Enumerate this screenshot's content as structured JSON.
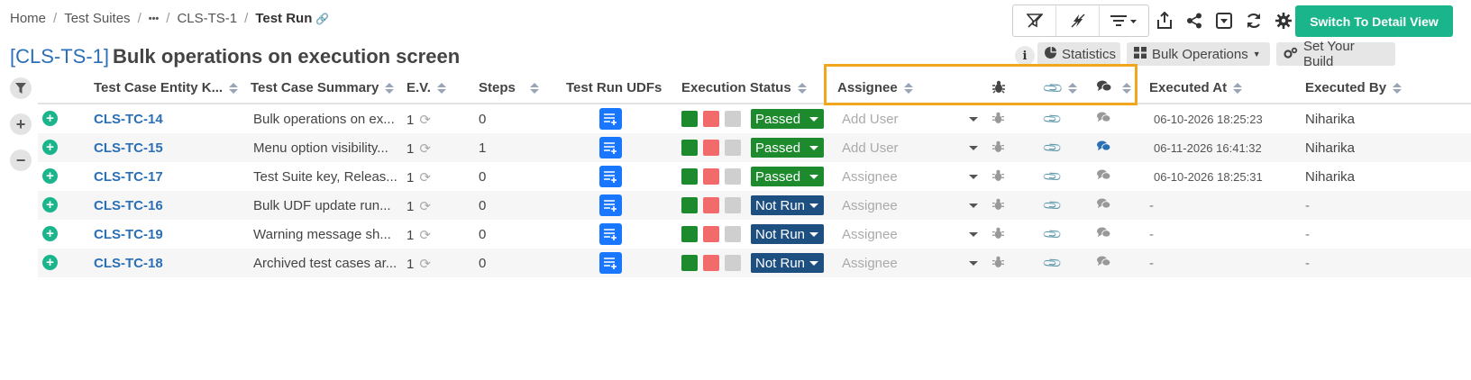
{
  "breadcrumb": {
    "home": "Home",
    "test_suites": "Test Suites",
    "more": "•••",
    "suite": "CLS-TS-1",
    "current": "Test Run"
  },
  "toolbar": {
    "primary_button": "Switch To Detail View"
  },
  "title": {
    "key": "[CLS-TS-1]",
    "name": "Bulk operations on execution screen"
  },
  "actions": {
    "statistics": "Statistics",
    "bulk_operations": "Bulk Operations",
    "set_build": "Set Your Build"
  },
  "columns": {
    "entity_key": "Test Case Entity K...",
    "summary": "Test Case Summary",
    "ev": "E.V.",
    "steps": "Steps",
    "udfs": "Test Run UDFs",
    "status": "Execution Status",
    "assignee": "Assignee",
    "executed_at": "Executed At",
    "executed_by": "Executed By"
  },
  "colors": {
    "primary": "#1bb58c",
    "link": "#2b6fb6",
    "passed": "#1e8a2e",
    "not_run": "#1d4f80",
    "highlight": "#f0a71e"
  },
  "rows": [
    {
      "key": "CLS-TC-14",
      "summary": "Bulk operations on ex...",
      "ev": "1",
      "steps": "0",
      "status": "Passed",
      "assignee": "Add User",
      "executed_at": "06-10-2026 18:25:23",
      "executed_by": "Niharika",
      "attach_active": false,
      "comment_active": false
    },
    {
      "key": "CLS-TC-15",
      "summary": "Menu option visibility...",
      "ev": "1",
      "steps": "1",
      "status": "Passed",
      "assignee": "Add User",
      "executed_at": "06-11-2026 16:41:32",
      "executed_by": "Niharika",
      "attach_active": true,
      "comment_active": true
    },
    {
      "key": "CLS-TC-17",
      "summary": "Test Suite key, Releas...",
      "ev": "1",
      "steps": "0",
      "status": "Passed",
      "assignee": "Assignee",
      "executed_at": "06-10-2026 18:25:31",
      "executed_by": "Niharika",
      "attach_active": false,
      "comment_active": false
    },
    {
      "key": "CLS-TC-16",
      "summary": "Bulk UDF update run...",
      "ev": "1",
      "steps": "0",
      "status": "Not Run",
      "assignee": "Assignee",
      "executed_at": "-",
      "executed_by": "-",
      "attach_active": false,
      "comment_active": false
    },
    {
      "key": "CLS-TC-19",
      "summary": "Warning message sh...",
      "ev": "1",
      "steps": "0",
      "status": "Not Run",
      "assignee": "Assignee",
      "executed_at": "-",
      "executed_by": "-",
      "attach_active": false,
      "comment_active": false
    },
    {
      "key": "CLS-TC-18",
      "summary": "Archived test cases ar...",
      "ev": "1",
      "steps": "0",
      "status": "Not Run",
      "assignee": "Assignee",
      "executed_at": "-",
      "executed_by": "-",
      "attach_active": false,
      "comment_active": false
    }
  ]
}
